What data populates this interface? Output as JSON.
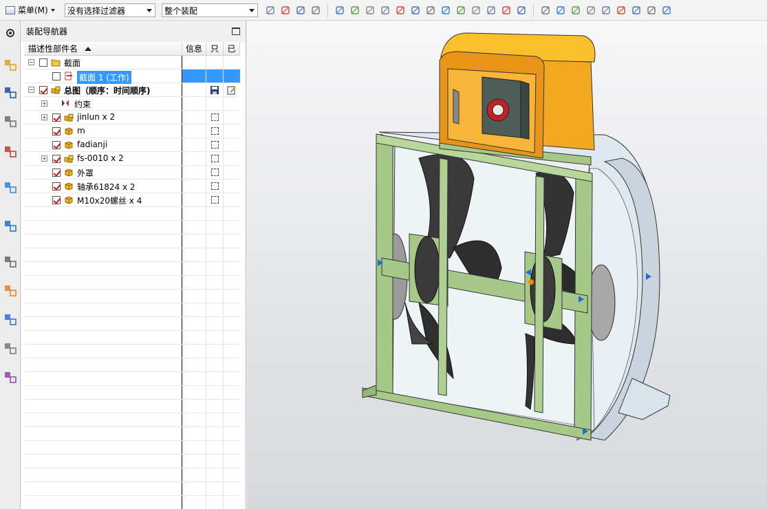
{
  "toolbar": {
    "menu_label": "菜单(M)",
    "filter_value": "没有选择过滤器",
    "scope_value": "整个装配",
    "icons": [
      "move-icon",
      "constraint-icon",
      "snap-icon",
      "pin-icon",
      "select-box-icon",
      "shaded-icon",
      "wireframe-icon",
      "points-icon",
      "line-icon",
      "line2-icon",
      "curve-icon",
      "spline-icon",
      "perpendicular-icon",
      "circle-icon",
      "crosshair-icon",
      "plus-icon",
      "diag-icon",
      "view-icon",
      "fit-icon",
      "zoom-icon",
      "rotate-icon",
      "layout-icon",
      "render-icon",
      "cube-icon",
      "shade-icon",
      "more-icon"
    ]
  },
  "side_strip": [
    "assembly-navigator-icon",
    "constraint-navigator-icon",
    "part-navigator-icon",
    "reuse-library-icon",
    "hd3d-icon",
    "web-browser-icon",
    "history-icon",
    "visualization-icon",
    "process-icon",
    "tools-icon",
    "roles-icon"
  ],
  "navigator": {
    "title": "装配导航器",
    "columns": [
      "描述性部件名",
      "信息",
      "只",
      "已"
    ],
    "rows": [
      {
        "label": "截面",
        "indent": 0,
        "expander": "−",
        "checkbox": "empty",
        "icon": "folder"
      },
      {
        "label": "截面 1 (工作)",
        "indent": 1,
        "expander": "",
        "checkbox": "empty",
        "icon": "section",
        "selected": true
      },
      {
        "label": "总图（顺序：时间顺序)",
        "indent": 0,
        "expander": "−",
        "checkbox": "checked",
        "icon": "assembly",
        "bold": true,
        "info_icon": "save",
        "ro_icon": "edit"
      },
      {
        "label": "约束",
        "indent": 1,
        "expander": "+",
        "checkbox": "none",
        "icon": "constraints"
      },
      {
        "label": "jinlun x 2",
        "indent": 1,
        "expander": "+",
        "checkbox": "checked",
        "icon": "assembly",
        "dotbox": true
      },
      {
        "label": "m",
        "indent": 1,
        "expander": "",
        "checkbox": "checked",
        "icon": "part",
        "dotbox": true
      },
      {
        "label": "fadianji",
        "indent": 1,
        "expander": "",
        "checkbox": "checked",
        "icon": "part",
        "dotbox": true
      },
      {
        "label": "fs-0010 x 2",
        "indent": 1,
        "expander": "+",
        "checkbox": "checked",
        "icon": "assembly",
        "dotbox": true
      },
      {
        "label": "外罩",
        "indent": 1,
        "expander": "",
        "checkbox": "checked",
        "icon": "part",
        "dotbox": true
      },
      {
        "label": "轴承61824 x 2",
        "indent": 1,
        "expander": "",
        "checkbox": "checked",
        "icon": "part",
        "dotbox": true
      },
      {
        "label": "M10x20螺丝 x 4",
        "indent": 1,
        "expander": "",
        "checkbox": "checked",
        "icon": "part",
        "dotbox": true
      }
    ],
    "empty_rows": 22
  },
  "colors": {
    "selection": "#3399ff",
    "frame_green": "#a6c989",
    "housing_orange": "#f0a21c",
    "shell_light": "#dde6ee",
    "blade_dark": "#2a2a2a"
  }
}
